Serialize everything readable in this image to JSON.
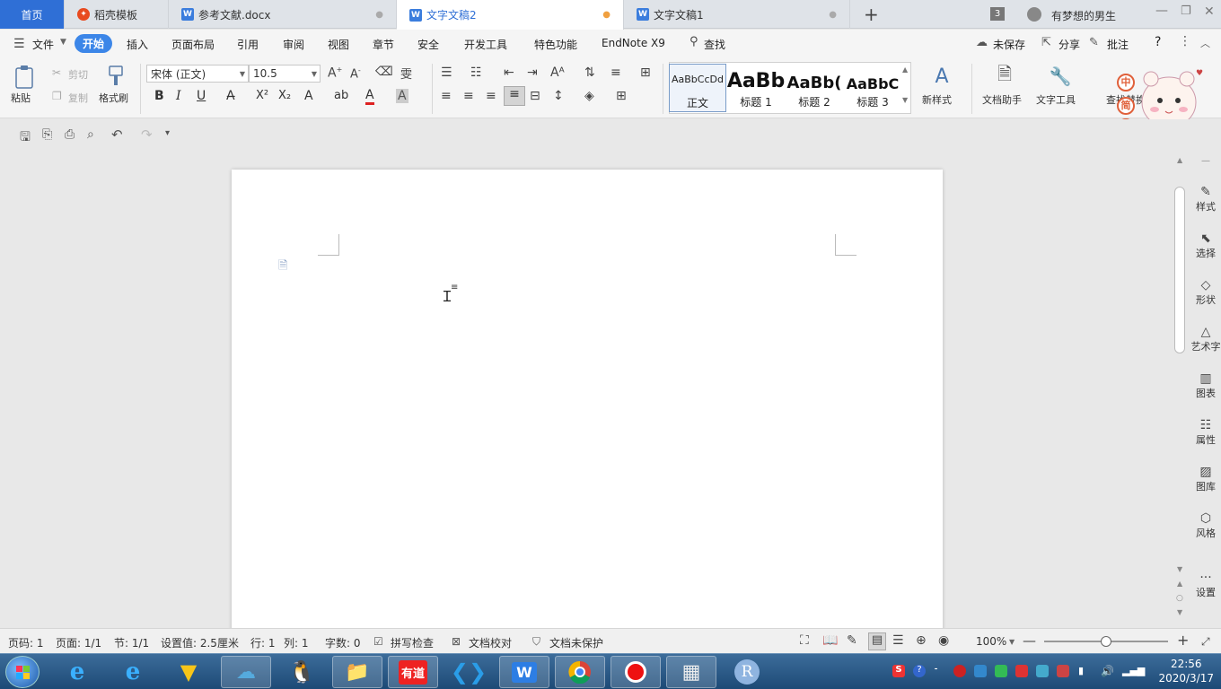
{
  "tabs": {
    "home": "首页",
    "daoke": "稻壳模板",
    "doc1": "参考文献.docx",
    "doc2": "文字文稿2",
    "doc3": "文字文稿1",
    "new": "+",
    "badge": "3",
    "user": "有梦想的男生"
  },
  "menu": {
    "file": "文件",
    "start": "开始",
    "insert": "插入",
    "layout": "页面布局",
    "ref": "引用",
    "review": "审阅",
    "view": "视图",
    "chapter": "章节",
    "security": "安全",
    "devtools": "开发工具",
    "features": "特色功能",
    "endnote": "EndNote X9",
    "search": "查找",
    "unsaved": "未保存",
    "share": "分享",
    "comment": "批注",
    "help": "?"
  },
  "ribbon": {
    "paste": "粘贴",
    "cut": "剪切",
    "copy": "复制",
    "format_painter": "格式刷",
    "font_name": "宋体 (正文)",
    "font_size": "10.5",
    "bold": "B",
    "italic": "I",
    "underline": "U",
    "styles": [
      {
        "preview": "AaBbCcDd",
        "label": "正文"
      },
      {
        "preview": "AaBb",
        "label": "标题 1"
      },
      {
        "preview": "AaBb(",
        "label": "标题 2"
      },
      {
        "preview": "AaBbC",
        "label": "标题 3"
      }
    ],
    "new_style": "新样式",
    "doc_assistant": "文档助手",
    "text_tools": "文字工具",
    "find_replace": "查找替换",
    "ime": [
      "中",
      "简"
    ]
  },
  "right_panel": [
    {
      "icon": "pen-icon",
      "label": "样式"
    },
    {
      "icon": "cursor-icon",
      "label": "选择"
    },
    {
      "icon": "shape-icon",
      "label": "形状"
    },
    {
      "icon": "art-text-icon",
      "label": "艺术字"
    },
    {
      "icon": "chart-icon",
      "label": "图表"
    },
    {
      "icon": "properties-icon",
      "label": "属性"
    },
    {
      "icon": "image-icon",
      "label": "图库"
    },
    {
      "icon": "style-icon",
      "label": "风格"
    },
    {
      "icon": "more-icon",
      "label": "设置"
    }
  ],
  "status": {
    "page": "页码: 1",
    "pages": "页面: 1/1",
    "section": "节: 1/1",
    "setting": "设置值: 2.5厘米",
    "row": "行: 1",
    "col": "列: 1",
    "words": "字数: 0",
    "spell": "拼写检查",
    "proof": "文档校对",
    "protect": "文档未保护",
    "zoom": "100%",
    "zoom_level": 0.5
  },
  "taskbar": {
    "time": "22:56",
    "date": "2020/3/17",
    "youdao": "有道",
    "r": "R"
  },
  "colors": {
    "accent": "#2f6fd6",
    "start_pill": "#3c86e8",
    "taskbar": "#2a5a88"
  }
}
